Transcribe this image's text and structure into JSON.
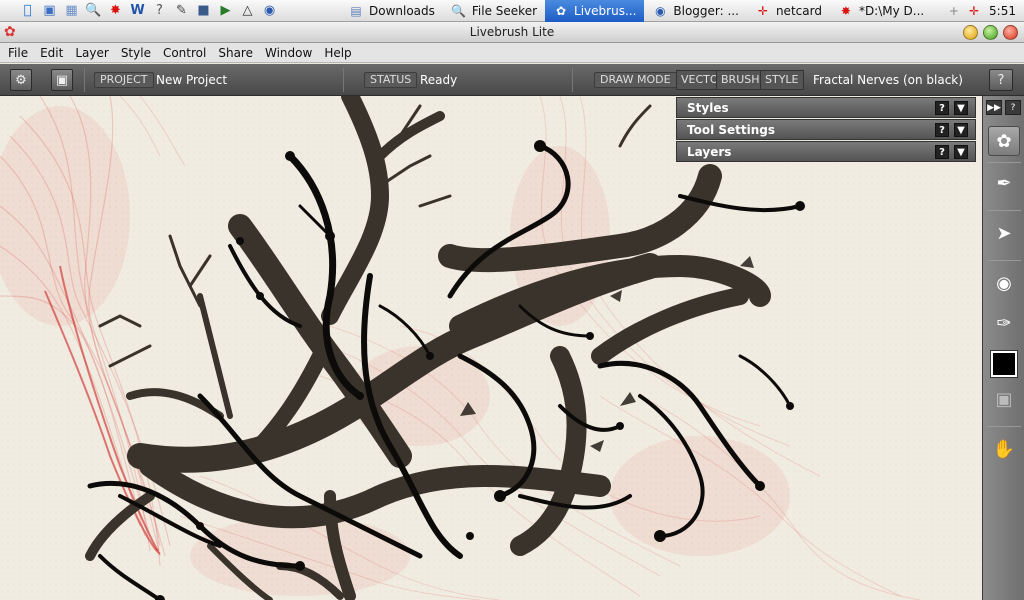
{
  "os_bar": {
    "quick_icons": [
      "apple-menu-icon",
      "finder-icon",
      "preview-icon",
      "search-icon",
      "paint-icon",
      "word-icon",
      "help-icon",
      "notes-icon",
      "book-icon",
      "media-icon",
      "torch-icon",
      "globe-icon"
    ],
    "tasks": [
      {
        "label": "Downloads",
        "icon": "folder-icon",
        "active": false
      },
      {
        "label": "File Seeker",
        "icon": "magnifier-icon",
        "active": false
      },
      {
        "label": "Livebrus...",
        "icon": "livebrush-icon",
        "active": true
      },
      {
        "label": "Blogger: ...",
        "icon": "browser-icon",
        "active": false
      },
      {
        "label": "netcard",
        "icon": "netcard-icon",
        "active": false
      },
      {
        "label": "*D:\\My D...",
        "icon": "paint-splat-icon",
        "active": false
      }
    ],
    "clock": "5:51"
  },
  "window": {
    "title": "Livebrush Lite"
  },
  "menu": [
    "File",
    "Edit",
    "Layer",
    "Style",
    "Control",
    "Share",
    "Window",
    "Help"
  ],
  "toolbar": {
    "project_label": "PROJECT",
    "project_value": "New Project",
    "status_label": "STATUS",
    "status_value": "Ready",
    "draw_mode_label": "DRAW MODE",
    "mode_tabs": [
      "VECTOR",
      "BRUSHES",
      "STYLE"
    ],
    "style_value": "Fractal Nerves (on black)",
    "help_label": "?"
  },
  "panels": [
    {
      "title": "Styles",
      "help": "?"
    },
    {
      "title": "Tool Settings",
      "help": "?"
    },
    {
      "title": "Layers",
      "help": "?"
    }
  ],
  "tool_strip": {
    "top_buttons": [
      "expand-icon",
      "help-icon"
    ],
    "tools": [
      "brush-tool-icon",
      "pen-tool-icon",
      "transform-tool-icon",
      "sampler-tool-icon",
      "eyedropper-tool-icon",
      "color-swatch",
      "lock-icon",
      "hand-tool-icon"
    ],
    "swatch_color": "#000000"
  },
  "colors": {
    "canvas_bg": "#f1ece1",
    "ink": "#3a332b",
    "red_strands": "#d42020",
    "toolbar_bg": "#555555"
  }
}
